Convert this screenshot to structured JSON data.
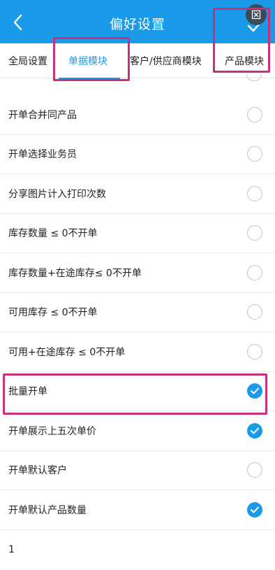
{
  "header": {
    "title": "偏好设置",
    "back_icon": "back-arrow-icon",
    "confirm_icon": "checkmark-icon",
    "overlay_icon": "expand-icon",
    "bg_color": "#1a9bea"
  },
  "tabs": [
    {
      "label": "全局设置",
      "active": false
    },
    {
      "label": "单据模块",
      "active": true
    },
    {
      "label": "客户/供应商模块",
      "active": false
    },
    {
      "label": "产品模块",
      "active": false
    }
  ],
  "settings": [
    {
      "label": "开单合并同产品",
      "checked": false
    },
    {
      "label": "开单选择业务员",
      "checked": false
    },
    {
      "label": "分享图片计入打印次数",
      "checked": false
    },
    {
      "label": "库存数量 ≤ 0不开单",
      "checked": false
    },
    {
      "label": "库存数量+在途库存≤ 0不开单",
      "checked": false
    },
    {
      "label": "可用库存 ≤ 0不开单",
      "checked": false
    },
    {
      "label": "可用+在途库存 ≤ 0不开单",
      "checked": false
    },
    {
      "label": "批量开单",
      "checked": true
    },
    {
      "label": "开单展示上五次单价",
      "checked": true
    },
    {
      "label": "开单默认客户",
      "checked": false
    },
    {
      "label": "开单默认产品数量",
      "checked": true
    }
  ],
  "default_quantity_value": "1",
  "colors": {
    "accent": "#1a9bea",
    "highlight": "#c8307a"
  }
}
